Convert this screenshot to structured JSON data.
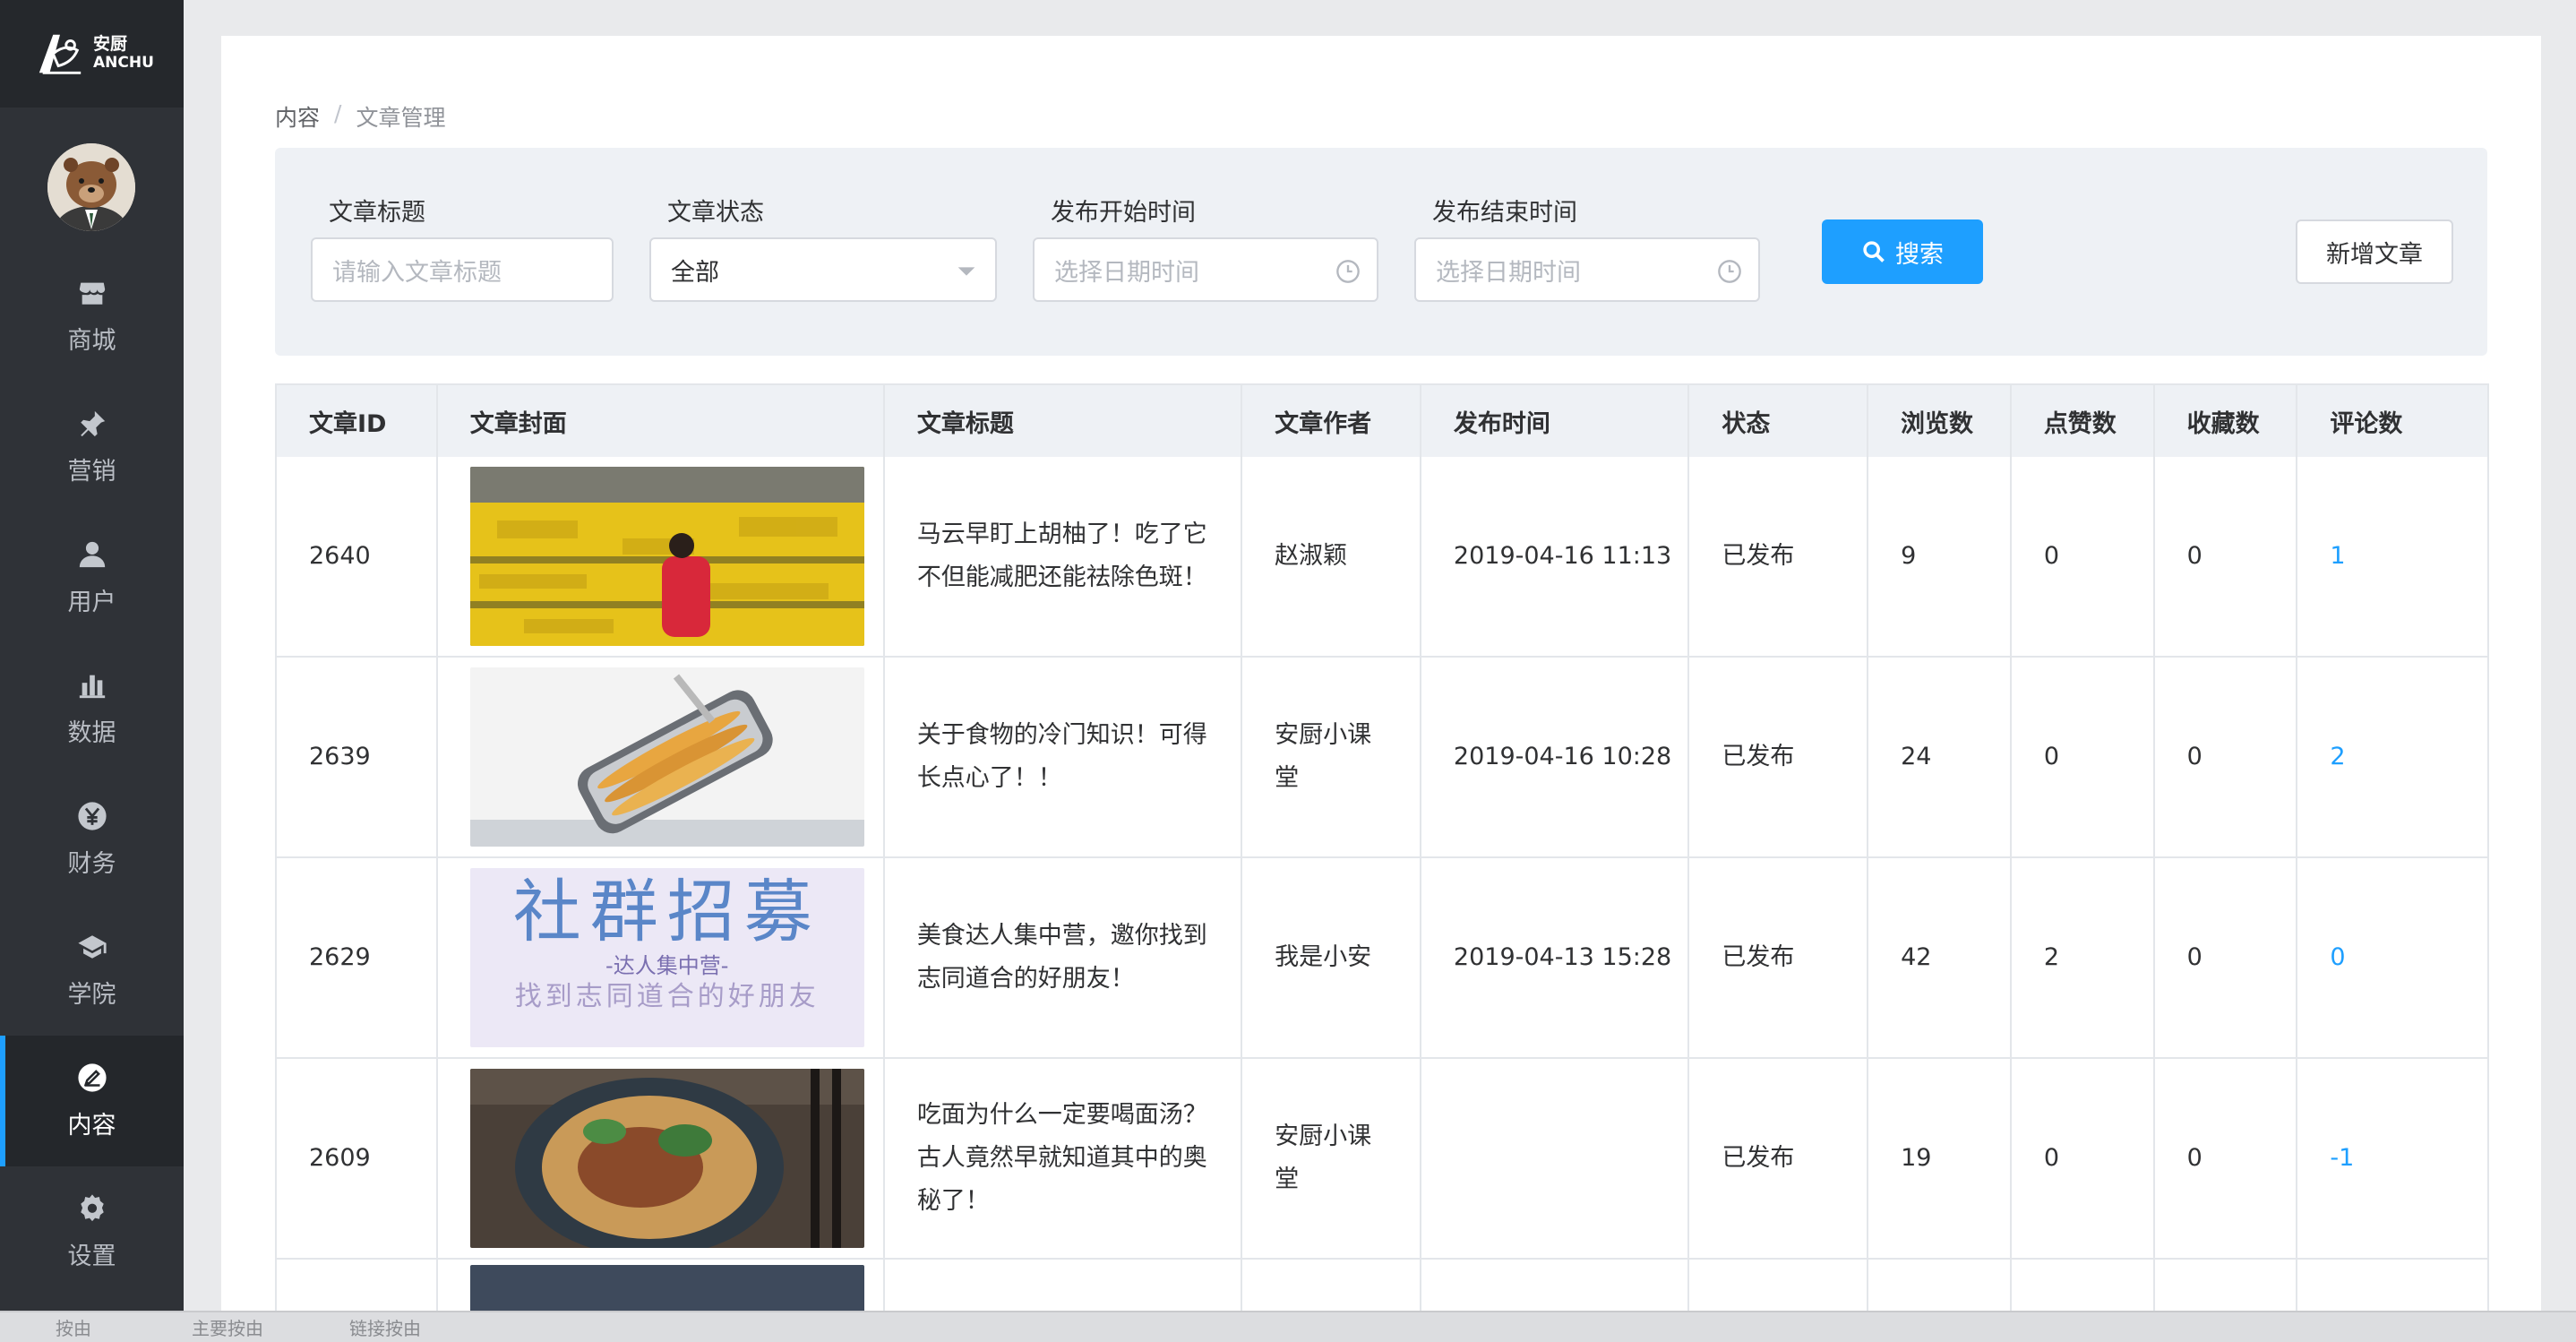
{
  "brand": {
    "cn": "安厨",
    "en": "ANCHU"
  },
  "nav": [
    {
      "label": "商城",
      "icon": "store-icon"
    },
    {
      "label": "营销",
      "icon": "pin-icon"
    },
    {
      "label": "用户",
      "icon": "user-icon"
    },
    {
      "label": "数据",
      "icon": "bar-chart-icon"
    },
    {
      "label": "财务",
      "icon": "yen-icon"
    },
    {
      "label": "学院",
      "icon": "graduation-cap-icon"
    },
    {
      "label": "内容",
      "icon": "edit-icon",
      "active": true
    },
    {
      "label": "设置",
      "icon": "gear-icon"
    }
  ],
  "breadcrumb": {
    "parent": "内容",
    "separator": "/",
    "current": "文章管理"
  },
  "filters": {
    "title_label": "文章标题",
    "title_placeholder": "请输入文章标题",
    "status_label": "文章状态",
    "status_value": "全部",
    "start_label": "发布开始时间",
    "start_placeholder": "选择日期时间",
    "end_label": "发布结束时间",
    "end_placeholder": "选择日期时间",
    "search_label": "搜索",
    "add_label": "新增文章"
  },
  "table": {
    "headers": [
      "文章ID",
      "文章封面",
      "文章标题",
      "文章作者",
      "发布时间",
      "状态",
      "浏览数",
      "点赞数",
      "收藏数",
      "评论数"
    ],
    "rows": [
      {
        "id": "2640",
        "cover": "cover-orchard",
        "title": "马云早盯上胡柚了！吃了它不但能减肥还能祛除色斑！",
        "author": "赵淑颖",
        "time": "2019-04-16 11:13",
        "status": "已发布",
        "views": "9",
        "likes": "0",
        "favs": "0",
        "comments": "1"
      },
      {
        "id": "2639",
        "cover": "cover-sardines",
        "title": "关于食物的冷门知识！可得长点心了！！",
        "author": "安厨小课堂",
        "time": "2019-04-16 10:28",
        "status": "已发布",
        "views": "24",
        "likes": "0",
        "favs": "0",
        "comments": "2"
      },
      {
        "id": "2629",
        "cover": "cover-recruit",
        "title": "美食达人集中营，邀你找到志同道合的好朋友！",
        "author": "我是小安",
        "time": "2019-04-13 15:28",
        "status": "已发布",
        "views": "42",
        "likes": "2",
        "favs": "0",
        "comments": "0"
      },
      {
        "id": "2609",
        "cover": "cover-noodles",
        "title": "吃面为什么一定要喝面汤？古人竟然早就知道其中的奥秘了！",
        "author": "安厨小课堂",
        "time": "",
        "status": "已发布",
        "views": "19",
        "likes": "0",
        "favs": "0",
        "comments": "-1"
      }
    ]
  },
  "cover_text": {
    "line1": "社群招募",
    "line2": "-达人集中营-",
    "line3": "找到志同道合的好朋友"
  },
  "bottom_strip": [
    "按由",
    "主要按由",
    "链接按由"
  ],
  "colors": {
    "accent": "#1e9fff",
    "sidebar": "#2f3237"
  }
}
